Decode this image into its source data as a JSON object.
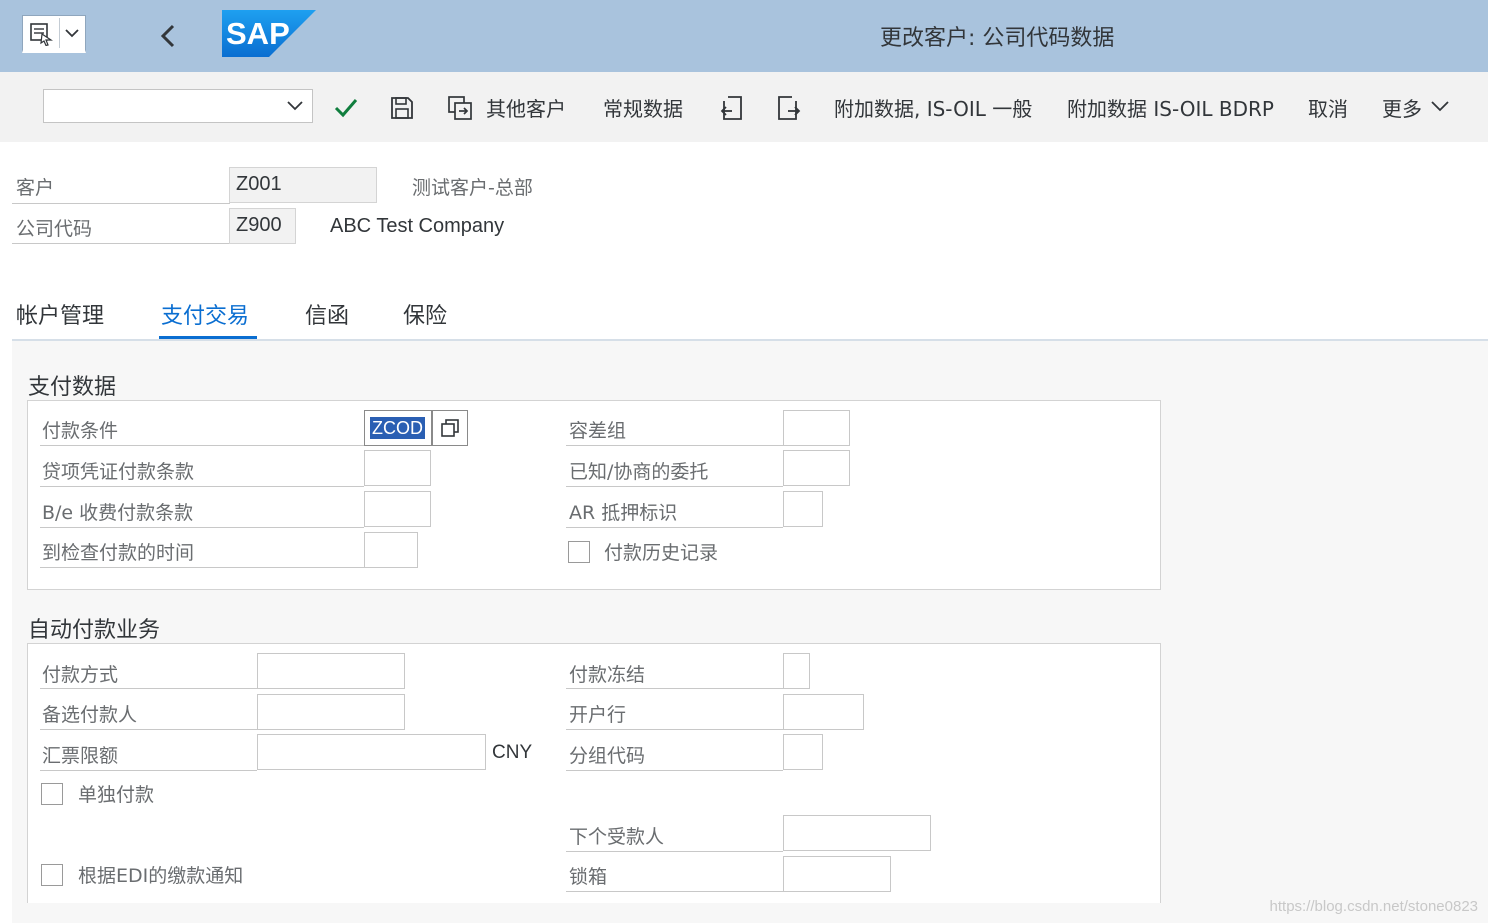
{
  "window": {
    "title": "更改客户: 公司代码数据"
  },
  "logo": {
    "text": "SAP",
    "color": "#0a6ed1"
  },
  "icons": {
    "menu": "menu-icon",
    "back": "back-arrow-icon",
    "check": "checkmark-icon",
    "save": "save-icon",
    "other_customer": "switch-object-icon",
    "prev": "previous-screen-icon",
    "next": "next-screen-icon",
    "f4": "value-help-icon"
  },
  "toolbar": {
    "command_value": "",
    "other_customer": "其他客户",
    "general_data": "常规数据",
    "additional_oil_general": "附加数据, IS-OIL 一般",
    "additional_oil_bdrp": "附加数据 IS-OIL BDRP",
    "cancel": "取消",
    "more": "更多"
  },
  "header": {
    "customer_label": "客户",
    "customer_value": "Z001",
    "customer_desc": "测试客户-总部",
    "company_label": "公司代码",
    "company_value": "Z900",
    "company_desc": "ABC Test Company"
  },
  "tabs": [
    {
      "label": "帐户管理",
      "active": false
    },
    {
      "label": "支付交易",
      "active": true
    },
    {
      "label": "信函",
      "active": false
    },
    {
      "label": "保险",
      "active": false
    }
  ],
  "payment_data": {
    "title": "支付数据",
    "payment_terms_label": "付款条件",
    "payment_terms_value": "ZCOD",
    "tolerance_group_label": "容差组",
    "tolerance_group_value": "",
    "credit_memo_terms_label": "贷项凭证付款条款",
    "credit_memo_terms_value": "",
    "known_negotiated_label": "已知/协商的委托",
    "known_negotiated_value": "",
    "be_charges_label": "B/e 收费付款条款",
    "be_charges_value": "",
    "ar_pledging_label": "AR 抵押标识",
    "ar_pledging_value": "",
    "check_cashing_label": "到检查付款的时间",
    "check_cashing_value": "",
    "payment_history_label": "付款历史记录",
    "payment_history_checked": false
  },
  "auto_payment": {
    "title": "自动付款业务",
    "payment_methods_label": "付款方式",
    "payment_methods_value": "",
    "payment_block_label": "付款冻结",
    "payment_block_value": "",
    "alt_payee_label": "备选付款人",
    "alt_payee_value": "",
    "house_bank_label": "开户行",
    "house_bank_value": "",
    "bill_limit_label": "汇票限额",
    "bill_limit_value": "",
    "bill_limit_currency": "CNY",
    "grouping_key_label": "分组代码",
    "grouping_key_value": "",
    "individual_payment_label": "单独付款",
    "individual_payment_checked": false,
    "next_payee_label": "下个受款人",
    "next_payee_value": "",
    "lockbox_label": "锁箱",
    "lockbox_value": "",
    "edi_advice_label": "根据EDI的缴款通知",
    "edi_advice_checked": false
  },
  "watermark": "https://blog.csdn.net/stone0823"
}
